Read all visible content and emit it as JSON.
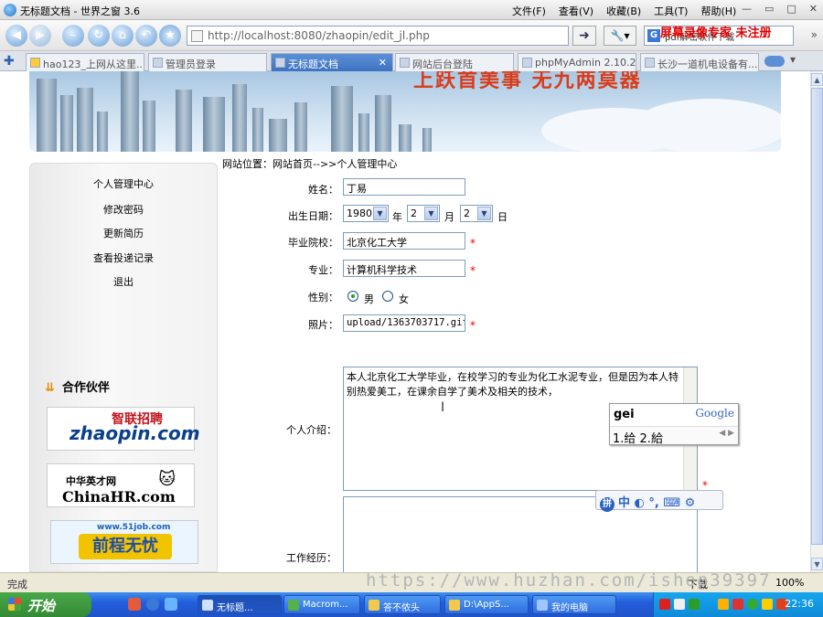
{
  "window": {
    "title": "无标题文档 - 世界之窗 3.6",
    "menus": [
      "文件(F)",
      "查看(V)",
      "收藏(B)",
      "工具(T)",
      "帮助(H)"
    ],
    "controls": [
      "—",
      "▭",
      "□",
      "✕"
    ]
  },
  "toolbar": {
    "url": "http://localhost:8080/zhaopin/edit_jl.php",
    "search_text": "pdf解密软件下载",
    "watermark": "屏幕录像专家  未注册"
  },
  "tabs": [
    {
      "label": "hao123_上网从这里..."
    },
    {
      "label": "管理员登录"
    },
    {
      "label": "无标题文档",
      "active": true
    },
    {
      "label": "网站后台登陆"
    },
    {
      "label": "phpMyAdmin 2.10.2..."
    },
    {
      "label": "长沙一道机电设备有..."
    }
  ],
  "banner": {
    "text": "上跃首美事  无九两莫器"
  },
  "sidebar": {
    "items": [
      "个人管理中心",
      "修改密码",
      "更新简历",
      "查看投递记录",
      "退出"
    ],
    "partner_title": "合作伙伴",
    "partners": [
      {
        "top": "智联招聘",
        "main": "zhaopin.com"
      },
      {
        "top": "中华英才网",
        "main": "ChinaHR.com"
      },
      {
        "top": "www.51job.com",
        "main": "前程无忧"
      }
    ]
  },
  "breadcrumb": "网站位置：网站首页-->>个人管理中心",
  "form": {
    "name_label": "姓名：",
    "name_value": "丁易",
    "birth_label": "出生日期：",
    "birth_year": "1980",
    "birth_year_unit": "年",
    "birth_month": "2",
    "birth_month_unit": "月",
    "birth_day": "2",
    "birth_day_unit": "日",
    "school_label": "毕业院校：",
    "school_value": "北京化工大学",
    "major_label": "专业：",
    "major_value": "计算机科学技术",
    "gender_label": "性别：",
    "gender_male": "男",
    "gender_female": "女",
    "gender_selected": "男",
    "photo_label": "照片：",
    "photo_value": "upload/1363703717.gif",
    "intro_label": "个人介绍：",
    "intro_value": "本人北京化工大学毕业，在校学习的专业为化工水泥专业，但是因为本人特别热爱美工，在课余自学了美术及相关的技术，",
    "work_label": "工作经历：",
    "required_mark": "*"
  },
  "ime": {
    "pinyin": "gei",
    "brand": "Google",
    "candidates": "1.给 2.給",
    "bar": "中 ◐ °, ⌨ ⚙"
  },
  "status": {
    "text": "完成",
    "download": "下载",
    "zoom": "100%",
    "watermark": "https://www.huzhan.com/ishop39397"
  },
  "taskbar": {
    "start": "开始",
    "tasks": [
      "无标题...",
      "Macrom...",
      "答不侬头",
      "D:\\AppS...",
      "我的电脑"
    ],
    "clock": "22:36"
  },
  "colors": {
    "accent": "#3e73c2",
    "required": "#e00000",
    "taskbar": "#245edb"
  }
}
